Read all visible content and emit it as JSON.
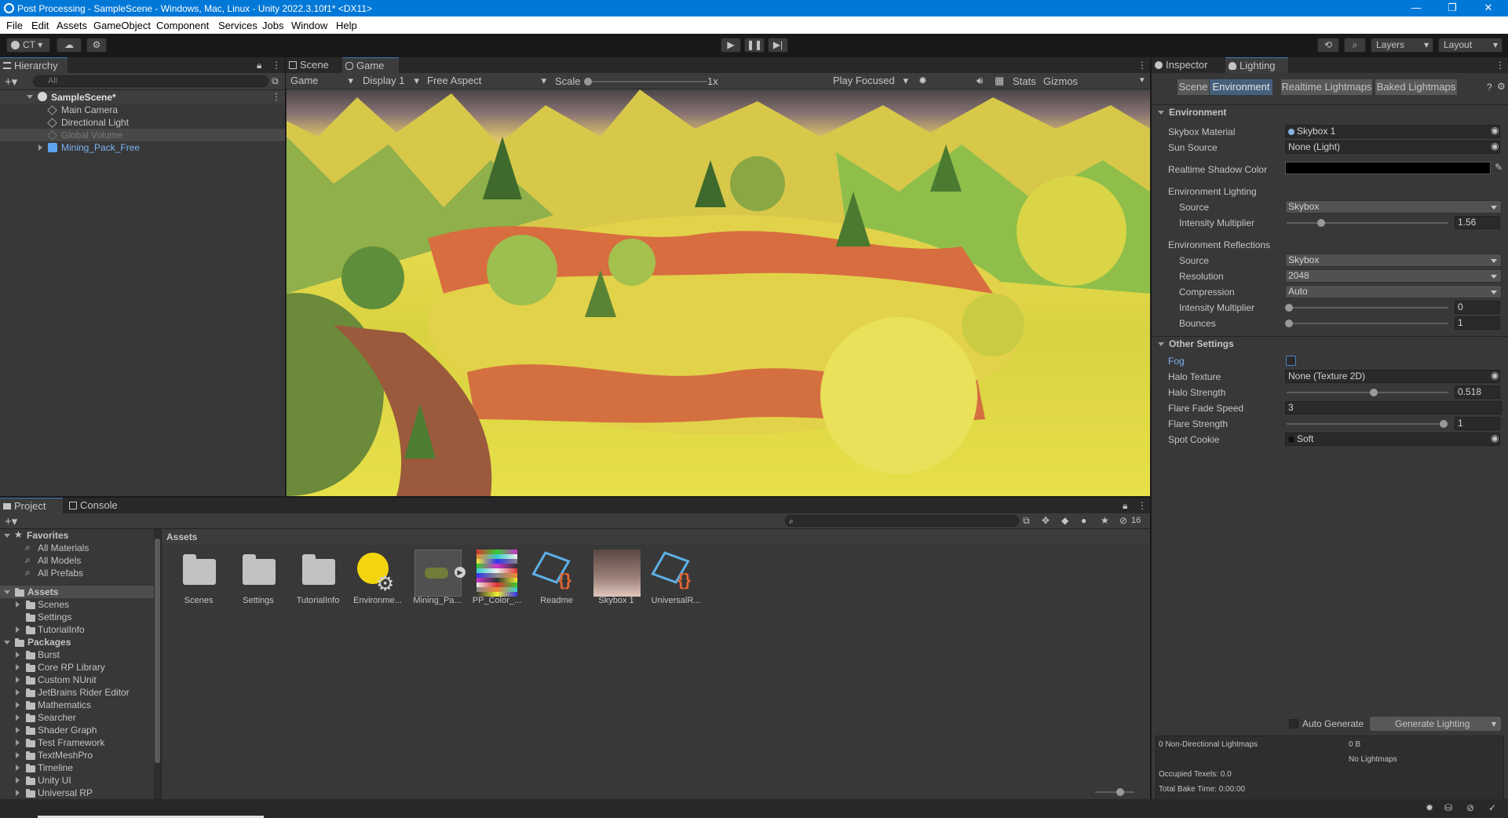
{
  "window": {
    "title": "Post Processing - SampleScene - Windows, Mac, Linux - Unity 2022.3.10f1* <DX11>",
    "controls": {
      "minimize": "—",
      "maximize": "❐",
      "close": "✕"
    }
  },
  "menu": [
    "File",
    "Edit",
    "Assets",
    "GameObject",
    "Component",
    "Services",
    "Jobs",
    "Window",
    "Help"
  ],
  "toolbar": {
    "account": "CT",
    "layers_label": "Layers",
    "layout_label": "Layout"
  },
  "hierarchy": {
    "tab": "Hierarchy",
    "search_placeholder": "All",
    "scene": "SampleScene*",
    "items": [
      {
        "label": "Main Camera",
        "state": "normal"
      },
      {
        "label": "Directional Light",
        "state": "normal"
      },
      {
        "label": "Global Volume",
        "state": "disabled"
      },
      {
        "label": "Mining_Pack_Free",
        "state": "prefab"
      }
    ]
  },
  "view": {
    "tabs": [
      "Scene",
      "Game"
    ],
    "game_dropdown": "Game",
    "display": "Display 1",
    "aspect": "Free Aspect",
    "scale_label": "Scale",
    "scale_value": "1x",
    "play_focused": "Play Focused",
    "stats": "Stats",
    "gizmos": "Gizmos"
  },
  "inspector": {
    "tabs": [
      "Inspector",
      "Lighting"
    ],
    "subtabs": [
      "Scene",
      "Environment",
      "Realtime Lightmaps",
      "Baked Lightmaps"
    ],
    "active_subtab": "Environment",
    "sections": {
      "environment": "Environment",
      "other": "Other Settings"
    },
    "fields": {
      "skybox_material_label": "Skybox Material",
      "skybox_material_value": "Skybox 1",
      "sun_source_label": "Sun Source",
      "sun_source_value": "None (Light)",
      "shadow_color_label": "Realtime Shadow Color",
      "env_lighting_label": "Environment Lighting",
      "source_label": "Source",
      "source_value": "Skybox",
      "intensity_label": "Intensity Multiplier",
      "intensity_value": "1.56",
      "intensity_fraction": 0.19,
      "env_reflections_label": "Environment Reflections",
      "refl_source_label": "Source",
      "refl_source_value": "Skybox",
      "resolution_label": "Resolution",
      "resolution_value": "2048",
      "compression_label": "Compression",
      "compression_value": "Auto",
      "refl_intensity_label": "Intensity Multiplier",
      "refl_intensity_value": "0",
      "bounces_label": "Bounces",
      "bounces_value": "1",
      "fog_label": "Fog",
      "halo_texture_label": "Halo Texture",
      "halo_texture_value": "None (Texture 2D)",
      "halo_strength_label": "Halo Strength",
      "halo_strength_value": "0.518",
      "flare_fade_label": "Flare Fade Speed",
      "flare_fade_value": "3",
      "flare_strength_label": "Flare Strength",
      "flare_strength_value": "1",
      "spot_cookie_label": "Spot Cookie",
      "spot_cookie_value": "Soft"
    },
    "auto_generate": "Auto Generate",
    "generate_button": "Generate Lighting",
    "stats": {
      "non_directional": "0 Non-Directional Lightmaps",
      "size": "0 B",
      "no_lightmaps": "No Lightmaps",
      "occupied": "Occupied Texels: 0.0",
      "bake_time": "Total Bake Time: 0:00:00"
    }
  },
  "project": {
    "tabs": [
      "Project",
      "Console"
    ],
    "hidden_count": "16",
    "breadcrumb": "Assets",
    "favorites_label": "Favorites",
    "favorites": [
      "All Materials",
      "All Models",
      "All Prefabs"
    ],
    "assets_label": "Assets",
    "asset_folders": [
      "Scenes",
      "Settings",
      "TutorialInfo"
    ],
    "packages_label": "Packages",
    "packages": [
      "Burst",
      "Core RP Library",
      "Custom NUnit",
      "JetBrains Rider Editor",
      "Mathematics",
      "Searcher",
      "Shader Graph",
      "Test Framework",
      "TextMeshPro",
      "Timeline",
      "Unity UI",
      "Universal RP"
    ],
    "grid": [
      {
        "label": "Scenes",
        "kind": "folder"
      },
      {
        "label": "Settings",
        "kind": "folder"
      },
      {
        "label": "TutorialInfo",
        "kind": "folder"
      },
      {
        "label": "Environme...",
        "kind": "lighting"
      },
      {
        "label": "Mining_Pa...",
        "kind": "prefab"
      },
      {
        "label": "PP_Color_...",
        "kind": "palette"
      },
      {
        "label": "Readme",
        "kind": "script"
      },
      {
        "label": "Skybox 1",
        "kind": "material"
      },
      {
        "label": "UniversalR...",
        "kind": "script"
      }
    ]
  },
  "colors": {
    "accent": "#2c5d87",
    "title_bar": "#0078d7",
    "prefab_text": "#7cb3f5"
  }
}
